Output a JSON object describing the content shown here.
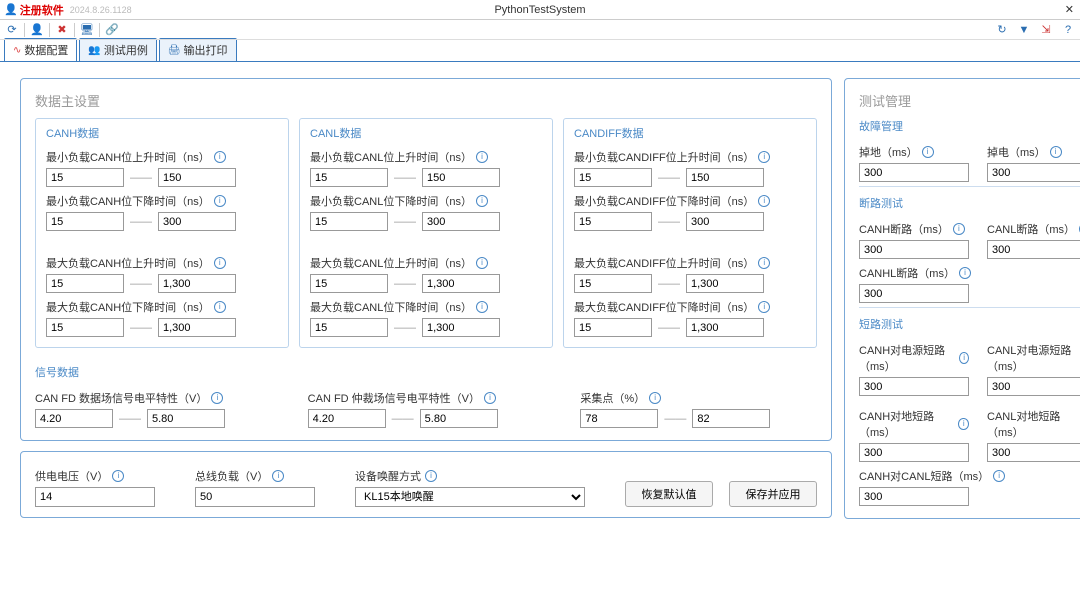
{
  "titlebar": {
    "register": "注册软件",
    "version": "2024.8.26.1128",
    "app": "PythonTestSystem"
  },
  "tabs": [
    {
      "icon": "⚡",
      "label": "数据配置",
      "active": true
    },
    {
      "icon": "👥",
      "label": "测试用例",
      "active": false
    },
    {
      "icon": "🖨",
      "label": "输出打印",
      "active": false
    }
  ],
  "main": {
    "title": "数据主设置",
    "canh": {
      "title": "CANH数据",
      "min_rise": {
        "label": "最小负载CANH位上升时间（ns）",
        "lo": "15",
        "hi": "150"
      },
      "min_fall": {
        "label": "最小负载CANH位下降时间（ns）",
        "lo": "15",
        "hi": "300"
      },
      "max_rise": {
        "label": "最大负载CANH位上升时间（ns）",
        "lo": "15",
        "hi": "1,300"
      },
      "max_fall": {
        "label": "最大负载CANH位下降时间（ns）",
        "lo": "15",
        "hi": "1,300"
      }
    },
    "canl": {
      "title": "CANL数据",
      "min_rise": {
        "label": "最小负载CANL位上升时间（ns）",
        "lo": "15",
        "hi": "150"
      },
      "min_fall": {
        "label": "最小负载CANL位下降时间（ns）",
        "lo": "15",
        "hi": "300"
      },
      "max_rise": {
        "label": "最大负载CANL位上升时间（ns）",
        "lo": "15",
        "hi": "1,300"
      },
      "max_fall": {
        "label": "最大负载CANL位下降时间（ns）",
        "lo": "15",
        "hi": "1,300"
      }
    },
    "candiff": {
      "title": "CANDIFF数据",
      "min_rise": {
        "label": "最小负载CANDIFF位上升时间（ns）",
        "lo": "15",
        "hi": "150"
      },
      "min_fall": {
        "label": "最小负载CANDIFF位下降时间（ns）",
        "lo": "15",
        "hi": "300"
      },
      "max_rise": {
        "label": "最大负载CANDIFF位上升时间（ns）",
        "lo": "15",
        "hi": "1,300"
      },
      "max_fall": {
        "label": "最大负载CANDIFF位下降时间（ns）",
        "lo": "15",
        "hi": "1,300"
      }
    },
    "signal": {
      "title": "信号数据",
      "data_level": {
        "label": "CAN FD 数据场信号电平特性（V）",
        "lo": "4.20",
        "hi": "5.80"
      },
      "arb_level": {
        "label": "CAN FD 仲裁场信号电平特性（V）",
        "lo": "4.20",
        "hi": "5.80"
      },
      "sample": {
        "label": "采集点（%）",
        "lo": "78",
        "hi": "82"
      }
    }
  },
  "bottom": {
    "vsupply": {
      "label": "供电电压（V）",
      "value": "14"
    },
    "busload": {
      "label": "总线负载（V）",
      "value": "50"
    },
    "wake": {
      "label": "设备唤醒方式",
      "value": "KL15本地唤醒"
    },
    "restore": "恢复默认值",
    "save": "保存并应用"
  },
  "right": {
    "title": "测试管理",
    "fault": {
      "title": "故障管理",
      "gnd": {
        "label": "掉地（ms）",
        "value": "300"
      },
      "pwr": {
        "label": "掉电（ms）",
        "value": "300"
      }
    },
    "open": {
      "title": "断路测试",
      "canh": {
        "label": "CANH断路（ms）",
        "value": "300"
      },
      "canl": {
        "label": "CANL断路（ms）",
        "value": "300"
      },
      "canhl": {
        "label": "CANHL断路（ms）",
        "value": "300"
      }
    },
    "short": {
      "title": "短路测试",
      "canh_pwr": {
        "label": "CANH对电源短路（ms）",
        "value": "300"
      },
      "canl_pwr": {
        "label": "CANL对电源短路（ms）",
        "value": "300"
      },
      "canh_gnd": {
        "label": "CANH对地短路（ms）",
        "value": "300"
      },
      "canl_gnd": {
        "label": "CANL对地短路（ms）",
        "value": "300"
      },
      "canh_canl": {
        "label": "CANH对CANL短路（ms）",
        "value": "300"
      }
    }
  }
}
